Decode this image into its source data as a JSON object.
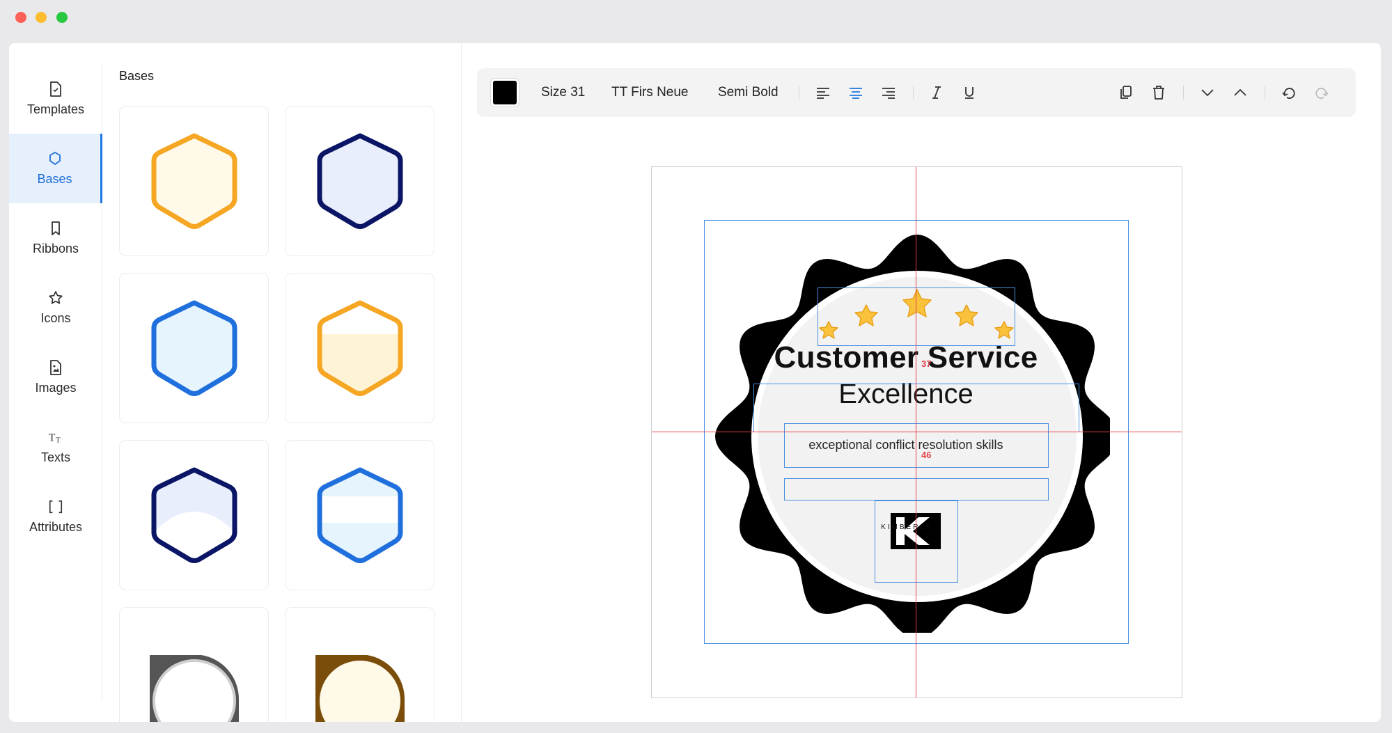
{
  "window": {
    "controls": [
      "close",
      "minimize",
      "zoom"
    ]
  },
  "nav": {
    "items": [
      {
        "label": "Templates",
        "icon": "file-icon",
        "active": false
      },
      {
        "label": "Bases",
        "icon": "shield-icon",
        "active": true
      },
      {
        "label": "Ribbons",
        "icon": "bookmark-icon",
        "active": false
      },
      {
        "label": "Icons",
        "icon": "star-icon",
        "active": false
      },
      {
        "label": "Images",
        "icon": "image-file-icon",
        "active": false
      },
      {
        "label": "Texts",
        "icon": "text-icon",
        "active": false
      },
      {
        "label": "Attributes",
        "icon": "brackets-icon",
        "active": false
      }
    ]
  },
  "panel": {
    "title": "Bases",
    "tiles": [
      {
        "name": "base-orange-light",
        "stroke": "#f5a623",
        "fill": "#fff9e9"
      },
      {
        "name": "base-navy-light",
        "stroke": "#0b1566",
        "fill": "#e8eefc"
      },
      {
        "name": "base-blue-light",
        "stroke": "#1f6fdc",
        "fill": "#e6f4fe"
      },
      {
        "name": "base-orange-half",
        "stroke": "#f5a623",
        "fill": "#fff9e9"
      },
      {
        "name": "base-navy-half",
        "stroke": "#0b1566",
        "fill": "#e8eefc"
      },
      {
        "name": "base-blue-band",
        "stroke": "#1f6fdc",
        "fill": "#e6f4fe"
      },
      {
        "name": "base-gray-circle",
        "stroke": "#555555",
        "fill": "#ffffff"
      },
      {
        "name": "base-brown-circle",
        "stroke": "#7a4e0a",
        "fill": "#fff9e9"
      }
    ]
  },
  "toolbar": {
    "color": "#000000",
    "size_label": "Size 31",
    "font_label": "TT Firs Neue",
    "weight_label": "Semi Bold",
    "align_active": "center"
  },
  "canvas": {
    "title": "Customer Service",
    "subtitle": "Excellence",
    "description": "exceptional conflict resolution skills",
    "logo_text": "KIMBERLY",
    "measure_top": "37",
    "measure_mid": "46",
    "colors": {
      "guide": "#e4434a",
      "selection": "#4a90e2",
      "seal": "#000000",
      "inner": "#f2f2f2",
      "star": "#f9c23c"
    }
  }
}
